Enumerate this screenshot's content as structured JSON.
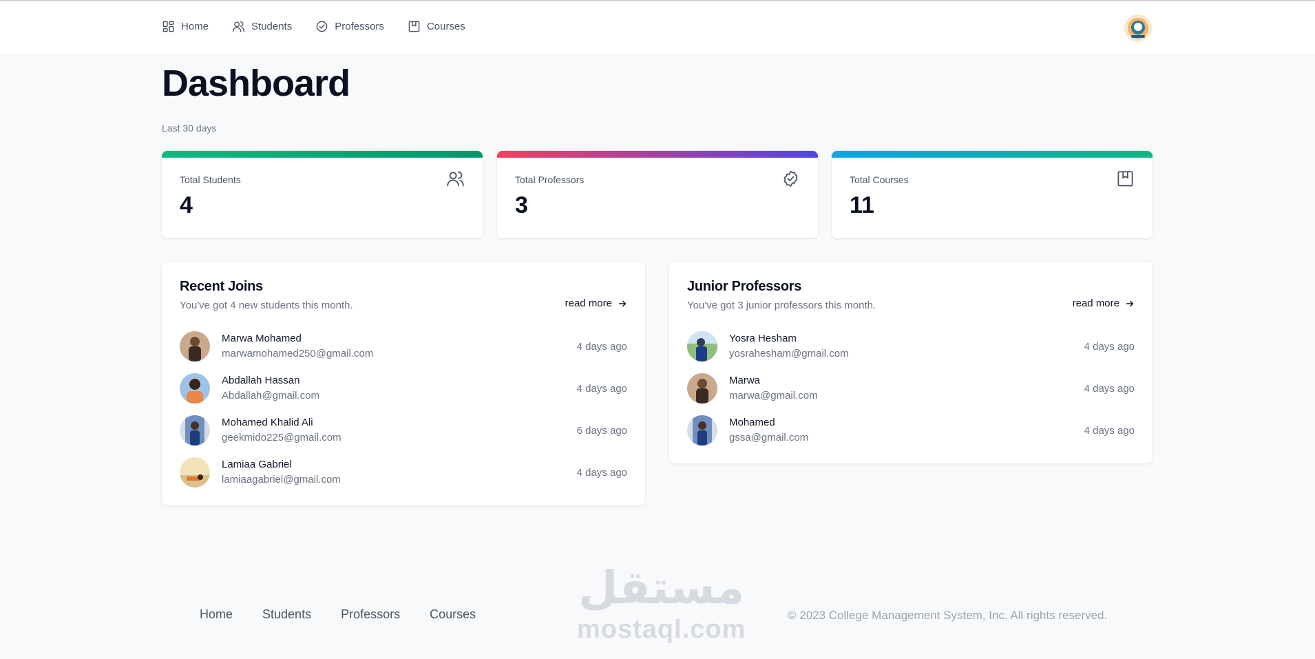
{
  "nav": {
    "items": [
      {
        "label": "Home",
        "icon": "grid-icon"
      },
      {
        "label": "Students",
        "icon": "users-icon"
      },
      {
        "label": "Professors",
        "icon": "badge-check-icon"
      },
      {
        "label": "Courses",
        "icon": "bookmark-icon"
      }
    ]
  },
  "page": {
    "title": "Dashboard",
    "subtitle": "Last 30 days"
  },
  "stats": [
    {
      "label": "Total Students",
      "value": "4",
      "icon": "users-icon",
      "gradient": [
        "#10b981",
        "#059669"
      ]
    },
    {
      "label": "Total Professors",
      "value": "3",
      "icon": "badge-check-icon",
      "gradient": [
        "#f43f5e",
        "#4f46e5"
      ]
    },
    {
      "label": "Total Courses",
      "value": "11",
      "icon": "bookmark-icon",
      "gradient": [
        "#0ea5e9",
        "#10b981"
      ]
    }
  ],
  "recent_joins": {
    "title": "Recent Joins",
    "subtitle": "You've got 4 new students this month.",
    "read_more": "read more",
    "rows": [
      {
        "name": "Marwa Mohamed",
        "email": "marwamohamed250@gmail.com",
        "time": "4 days ago"
      },
      {
        "name": "Abdallah Hassan",
        "email": "Abdallah@gmail.com",
        "time": "4 days ago"
      },
      {
        "name": "Mohamed Khalid Ali",
        "email": "geekmido225@gmail.com",
        "time": "6 days ago"
      },
      {
        "name": "Lamiaa Gabriel",
        "email": "lamiaagabriel@gmail.com",
        "time": "4 days ago"
      }
    ]
  },
  "junior_professors": {
    "title": "Junior Professors",
    "subtitle": "You've got 3 junior professors this month.",
    "read_more": "read more",
    "rows": [
      {
        "name": "Yosra Hesham",
        "email": "yosrahesham@gmail.com",
        "time": "4 days ago"
      },
      {
        "name": "Marwa",
        "email": "marwa@gmail.com",
        "time": "4 days ago"
      },
      {
        "name": "Mohamed",
        "email": "gssa@gmail.com",
        "time": "4 days ago"
      }
    ]
  },
  "footer": {
    "links": [
      "Home",
      "Students",
      "Professors",
      "Courses"
    ],
    "copyright": "© 2023 College Management System, Inc. All rights reserved."
  },
  "watermark": {
    "arabic": "مستقل",
    "latin": "mostaql.com"
  }
}
